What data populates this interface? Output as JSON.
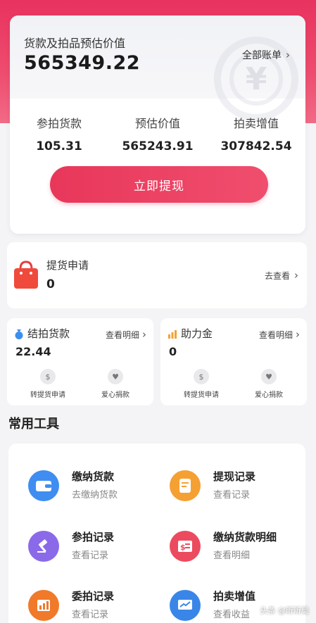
{
  "balance": {
    "label": "货款及拍品预估价值",
    "value": "565349.22",
    "all_accounts": "全部账单"
  },
  "stats": [
    {
      "label": "参拍货款",
      "value": "105.31"
    },
    {
      "label": "预估价值",
      "value": "565243.91"
    },
    {
      "label": "拍卖增值",
      "value": "307842.54"
    }
  ],
  "withdraw_label": "立即提现",
  "pickup": {
    "label": "提货申请",
    "value": "0",
    "action": "去查看"
  },
  "settled": {
    "title": "结拍货款",
    "detail": "查看明细",
    "value": "22.44",
    "actions": [
      "转提货申请",
      "爱心捐款"
    ]
  },
  "assist": {
    "title": "助力金",
    "detail": "查看明细",
    "value": "0",
    "actions": [
      "转提货申请",
      "爱心捐款"
    ]
  },
  "tools_title": "常用工具",
  "tools": [
    {
      "title": "缴纳货款",
      "sub": "去缴纳货款",
      "icon": "wallet-icon",
      "color": "#3f8df0"
    },
    {
      "title": "提现记录",
      "sub": "查看记录",
      "icon": "receipt-icon",
      "color": "#f5a033"
    },
    {
      "title": "参拍记录",
      "sub": "查看记录",
      "icon": "gavel-icon",
      "color": "#8a6ae8"
    },
    {
      "title": "缴纳货款明细",
      "sub": "查看明细",
      "icon": "bill-icon",
      "color": "#ec4b5f"
    },
    {
      "title": "委拍记录",
      "sub": "查看记录",
      "icon": "chart-bar-icon",
      "color": "#f07a2a"
    },
    {
      "title": "拍卖增值",
      "sub": "查看收益",
      "icon": "growth-icon",
      "color": "#3a86e8"
    }
  ],
  "watermark": "头条 @昕昕局",
  "colors": {
    "accent": "#e8375a",
    "header": "#e8325f"
  }
}
